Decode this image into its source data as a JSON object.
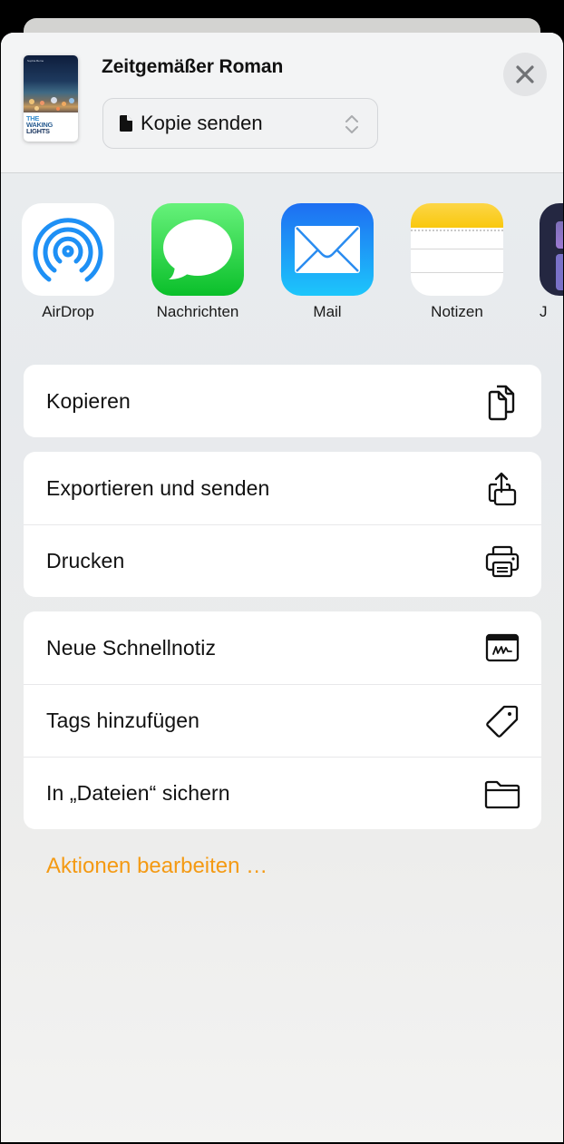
{
  "header": {
    "document_title": "Zeitgemäßer Roman",
    "thumbnail": {
      "author": "Sophia Berne",
      "title_lines": [
        "THE",
        "WAKING",
        "LIGHTS"
      ]
    },
    "mode_select": {
      "value": "Kopie senden",
      "icon": "doc-icon"
    },
    "close_icon": "xmark-icon"
  },
  "apps": [
    {
      "label": "AirDrop",
      "icon": "airdrop-icon"
    },
    {
      "label": "Nachrichten",
      "icon": "messages-icon"
    },
    {
      "label": "Mail",
      "icon": "mail-icon"
    },
    {
      "label": "Notizen",
      "icon": "notes-icon"
    },
    {
      "label": "J",
      "icon": "partial-app-icon"
    }
  ],
  "action_groups": [
    [
      {
        "label": "Kopieren",
        "icon": "copy-icon"
      }
    ],
    [
      {
        "label": "Exportieren und senden",
        "icon": "export-share-icon"
      },
      {
        "label": "Drucken",
        "icon": "printer-icon"
      }
    ],
    [
      {
        "label": "Neue Schnellnotiz",
        "icon": "quick-note-icon"
      },
      {
        "label": "Tags hinzufügen",
        "icon": "tag-icon"
      },
      {
        "label": "In „Dateien“ sichern",
        "icon": "folder-icon"
      }
    ]
  ],
  "edit_actions_link": "Aktionen bearbeiten …",
  "colors": {
    "accent": "#f49a13",
    "airdrop": "#1e90f5",
    "messages_green": "#0abf2a",
    "mail_blue": "#1e6ef2",
    "notes_yellow": "#f9c80e"
  }
}
